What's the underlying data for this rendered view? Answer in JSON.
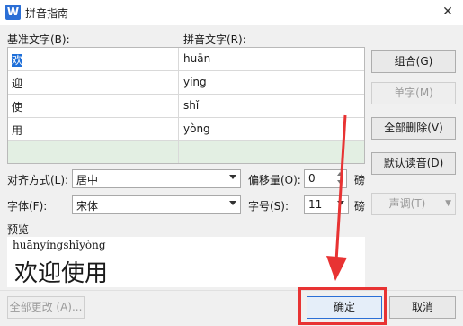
{
  "window": {
    "title": "拼音指南",
    "icon_letter": "W",
    "close_glyph": "✕"
  },
  "grid": {
    "base_header": "基准文字(B):",
    "ruby_header": "拼音文字(R):",
    "rows": [
      {
        "base": "欢",
        "ruby": "huān"
      },
      {
        "base": "迎",
        "ruby": "yíng"
      },
      {
        "base": "使",
        "ruby": "shǐ"
      },
      {
        "base": "用",
        "ruby": "yòng"
      },
      {
        "base": "",
        "ruby": ""
      }
    ]
  },
  "buttons": {
    "combine": "组合(G)",
    "single": "单字(M)",
    "clear_all": "全部删除(V)",
    "default_reading": "默认读音(D)",
    "tone": "声调(T)",
    "apply_all": "全部更改 (A)...",
    "ok": "确定",
    "cancel": "取消"
  },
  "options": {
    "alignment_label": "对齐方式(L):",
    "alignment_value": "居中",
    "offset_label": "偏移量(O):",
    "offset_value": "0",
    "offset_unit": "磅",
    "font_label": "字体(F):",
    "font_value": "宋体",
    "size_label": "字号(S):",
    "size_value": "11",
    "size_unit": "磅"
  },
  "preview": {
    "label": "预览",
    "pinyin": "huānyíngshǐyòng",
    "text": "欢迎使用"
  },
  "colors": {
    "annotation": "#e83333",
    "selection": "#1e6fd9",
    "empty_row": "#e3efe3"
  }
}
